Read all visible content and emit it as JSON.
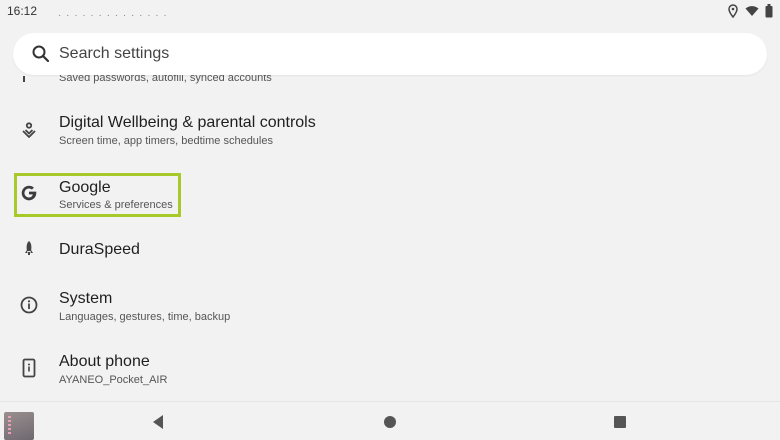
{
  "status_bar": {
    "time": "16:12",
    "icons": [
      "location-icon",
      "wifi-icon",
      "battery-icon"
    ]
  },
  "search": {
    "placeholder": "Search settings"
  },
  "settings_items": [
    {
      "icon": "password-key-icon",
      "subtitle": "Saved passwords, autofill, synced accounts"
    },
    {
      "icon": "digital-wellbeing-icon",
      "title": "Digital Wellbeing & parental controls",
      "subtitle": "Screen time, app timers, bedtime schedules"
    },
    {
      "icon": "google-g-icon",
      "title": "Google",
      "subtitle": "Services & preferences"
    },
    {
      "icon": "rocket-icon",
      "title": "DuraSpeed"
    },
    {
      "icon": "info-icon",
      "title": "System",
      "subtitle": "Languages, gestures, time, backup"
    },
    {
      "icon": "phone-info-icon",
      "title": "About phone",
      "subtitle": "AYANEO_Pocket_AIR"
    }
  ],
  "colors": {
    "background": "#f2f2f2",
    "highlight": "#a8c92a",
    "text_primary": "#1f1f1f",
    "text_secondary": "#555555"
  },
  "nav_bar": {
    "buttons": [
      "back-icon",
      "home-icon",
      "recents-icon"
    ]
  }
}
